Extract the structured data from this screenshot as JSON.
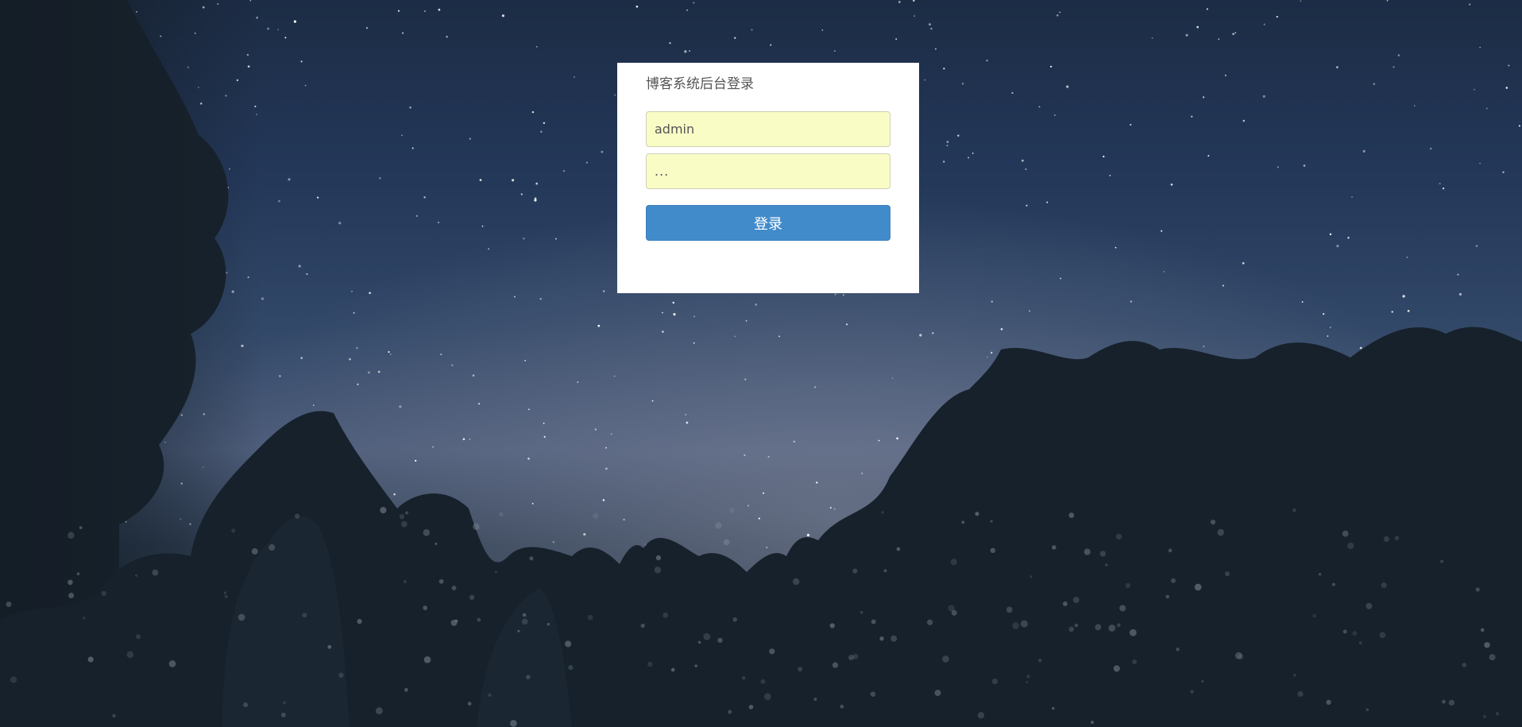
{
  "login": {
    "title": "博客系统后台登录",
    "username": {
      "value": "admin"
    },
    "password": {
      "value": "..."
    },
    "submit_label": "登录"
  },
  "colors": {
    "card_background": "#ffffff",
    "input_autofill": "#fafcc6",
    "button_primary": "#428bca",
    "sky_top": "#1c2c45",
    "tree_silhouette": "#16212b"
  },
  "background": {
    "scene": "night-sky-with-stars-and-tree-silhouettes"
  }
}
